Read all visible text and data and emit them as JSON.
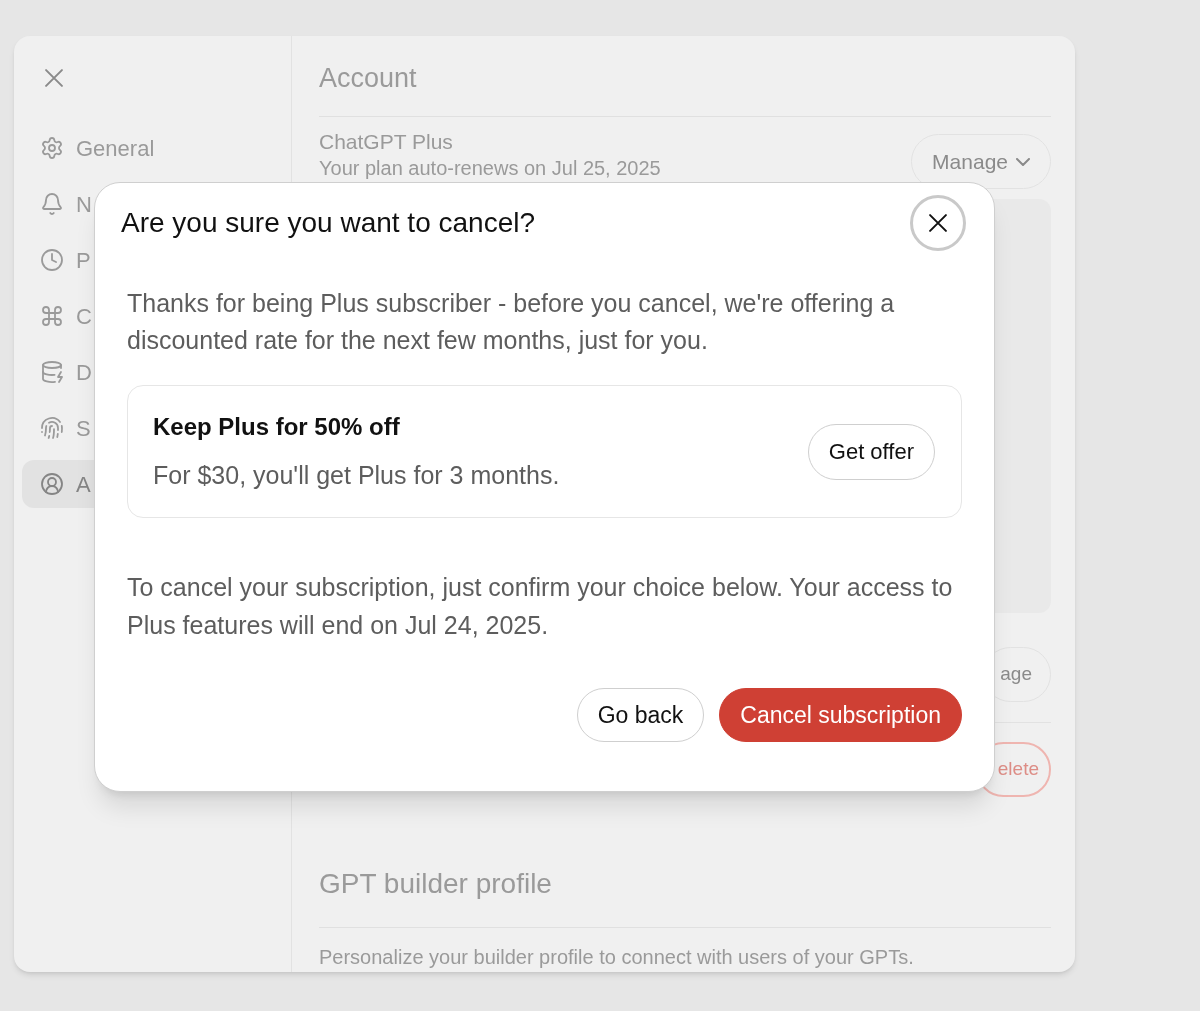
{
  "settings": {
    "sidebar": {
      "items": [
        {
          "label": "General",
          "selected": false
        },
        {
          "label": "N",
          "selected": false
        },
        {
          "label": "P",
          "selected": false
        },
        {
          "label": "C",
          "selected": false
        },
        {
          "label": "D",
          "selected": false
        },
        {
          "label": "S",
          "selected": false
        },
        {
          "label": "A",
          "selected": true
        }
      ]
    },
    "title": "Account",
    "plan": {
      "name": "ChatGPT Plus",
      "detail": "Your plan auto-renews on Jul 25, 2025",
      "button": "Manage"
    },
    "payment_button": "age",
    "delete_button": "elete",
    "builder": {
      "title": "GPT builder profile",
      "detail": "Personalize your builder profile to connect with users of your GPTs."
    }
  },
  "dialog": {
    "title": "Are you sure you want to cancel?",
    "intro": "Thanks for being Plus subscriber - before you cancel, we're offering a discounted rate for the next few months, just for you.",
    "offer": {
      "title": "Keep Plus for 50% off",
      "detail": "For $30, you'll get Plus for 3 months.",
      "button": "Get offer"
    },
    "note": "To cancel your subscription, just confirm your choice below. Your access to Plus features will end on Jul 24, 2025.",
    "buttons": [
      {
        "label": "Go back",
        "kind": "secondary"
      },
      {
        "label": "Cancel subscription",
        "kind": "danger"
      }
    ]
  }
}
